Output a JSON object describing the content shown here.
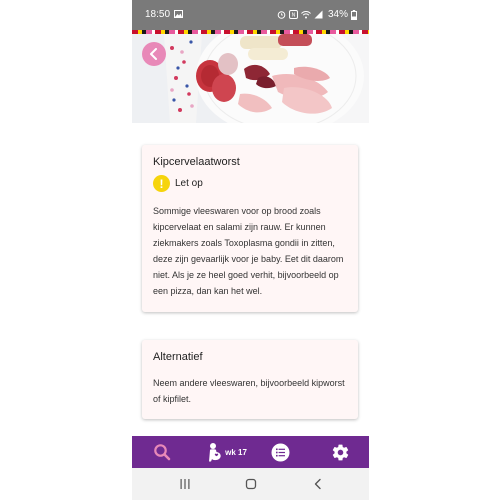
{
  "status_bar": {
    "time": "18:50",
    "battery": "34%"
  },
  "article": {
    "title": "Kipcervelaatworst",
    "warning_label": "Let op",
    "body": "Sommige vleeswaren voor op brood zoals kipcervelaat en salami zijn rauw. Er kunnen ziekmakers zoals Toxoplasma gondii in zitten, deze zijn gevaarlijk voor je baby. Eet dit daarom niet. Als je ze heel goed verhit, bijvoorbeeld op een pizza, dan kan het wel."
  },
  "alternative": {
    "title": "Alternatief",
    "body": "Neem andere vleeswaren, bijvoorbeeld kipworst of kipfilet."
  },
  "bottom_nav": {
    "week_label": "wk 17",
    "icons": [
      "search-icon",
      "pregnancy-icon",
      "list-icon",
      "gear-icon"
    ]
  },
  "colors": {
    "nav_bg": "#6f2a91",
    "accent_pink": "#e889b8",
    "warning_yellow": "#f6d40c",
    "card_bg": "#fff6f6"
  }
}
